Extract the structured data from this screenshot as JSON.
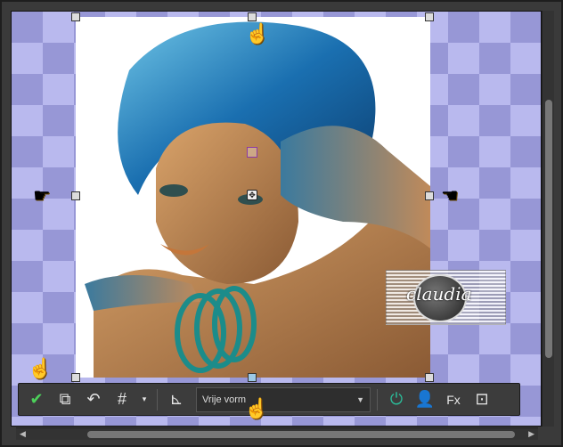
{
  "toolbar": {
    "apply_icon": "checkmark-icon",
    "mode_dropdown_value": "Vrije vorm",
    "items": [
      "apply",
      "transform",
      "reset",
      "grid",
      "grid-menu",
      "align",
      "mode",
      "power",
      "portrait",
      "effects",
      "screen-capture"
    ]
  },
  "watermark": {
    "text": "claudia"
  },
  "colors": {
    "checker_dark": "#9797d6",
    "checker_light": "#b9b9ee",
    "toolbar_bg": "#3c3c3c",
    "accent_green": "#2bbd9a"
  }
}
